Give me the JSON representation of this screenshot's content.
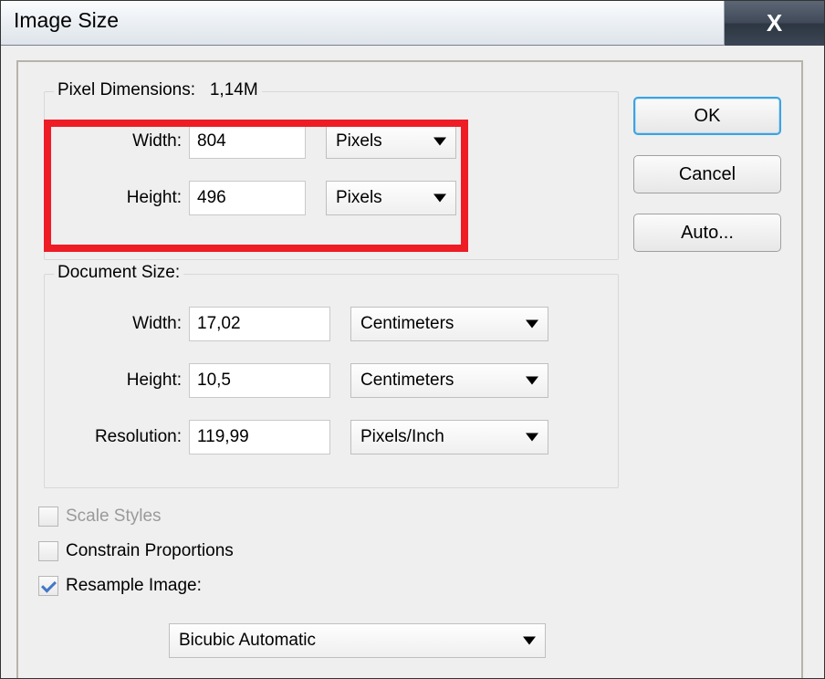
{
  "window": {
    "title": "Image Size"
  },
  "pixel_dimensions": {
    "legend": "Pixel Dimensions:",
    "size_label": "1,14M",
    "width_label": "Width:",
    "height_label": "Height:",
    "width_value": "804",
    "height_value": "496",
    "width_unit": "Pixels",
    "height_unit": "Pixels"
  },
  "document_size": {
    "legend": "Document Size:",
    "width_label": "Width:",
    "height_label": "Height:",
    "resolution_label": "Resolution:",
    "width_value": "17,02",
    "height_value": "10,5",
    "resolution_value": "119,99",
    "width_unit": "Centimeters",
    "height_unit": "Centimeters",
    "resolution_unit": "Pixels/Inch"
  },
  "buttons": {
    "ok": "OK",
    "cancel": "Cancel",
    "auto": "Auto..."
  },
  "checkboxes": {
    "scale_styles": {
      "label": "Scale Styles",
      "checked": false,
      "enabled": false
    },
    "constrain_proportions": {
      "label": "Constrain Proportions",
      "checked": false,
      "enabled": true
    },
    "resample_image": {
      "label": "Resample Image:",
      "checked": true,
      "enabled": true
    }
  },
  "resample": {
    "method": "Bicubic Automatic"
  }
}
